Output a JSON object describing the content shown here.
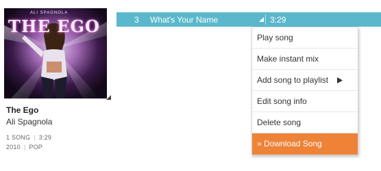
{
  "album": {
    "art_alt": "The Ego album cover",
    "art_text": "THE EGO",
    "art_small_text": "ALI SPAGNOLA",
    "title": "The Ego",
    "artist": "Ali Spagnola",
    "song_count": "1 SONG",
    "duration": "3:29",
    "year": "2010",
    "genre": "POP"
  },
  "track": {
    "number": "3",
    "name": "What's Your Name",
    "duration": "3:29"
  },
  "context_menu": {
    "items": [
      {
        "label": "Play song"
      },
      {
        "label": "Make instant mix"
      },
      {
        "label": "Add song to playlist"
      },
      {
        "label": "Edit song info"
      },
      {
        "label": "Delete song"
      },
      {
        "label": "» Download Song"
      }
    ]
  },
  "colors": {
    "track_row_bg": "#5bb8cc",
    "highlight_bg": "#ee8236",
    "text_dark": "#222222"
  },
  "icons": {
    "album_menu": "dropdown-triangle-icon",
    "track_menu": "dropdown-triangle-icon",
    "submenu": "submenu-arrow-icon"
  }
}
